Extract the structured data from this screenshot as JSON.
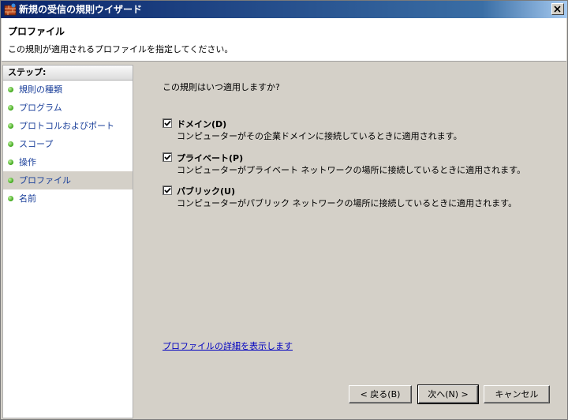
{
  "window": {
    "title": "新規の受信の規則ウイザード"
  },
  "header": {
    "title": "プロファイル",
    "subtitle": "この規則が適用されるプロファイルを指定してください。"
  },
  "steps": {
    "header": "ステップ:",
    "items": [
      {
        "label": "規則の種類",
        "active": false
      },
      {
        "label": "プログラム",
        "active": false
      },
      {
        "label": "プロトコルおよびポート",
        "active": false
      },
      {
        "label": "スコープ",
        "active": false
      },
      {
        "label": "操作",
        "active": false
      },
      {
        "label": "プロファイル",
        "active": true
      },
      {
        "label": "名前",
        "active": false
      }
    ]
  },
  "main": {
    "question": "この規則はいつ適用しますか?",
    "options": [
      {
        "label": "ドメイン(D)",
        "description": "コンピューターがその企業ドメインに接続しているときに適用されます。",
        "checked": true
      },
      {
        "label": "プライベート(P)",
        "description": "コンピューターがプライベート ネットワークの場所に接続しているときに適用されます。",
        "checked": true
      },
      {
        "label": "パブリック(U)",
        "description": "コンピューターがパブリック ネットワークの場所に接続しているときに適用されます。",
        "checked": true
      }
    ],
    "link": "プロファイルの詳細を表示します"
  },
  "buttons": {
    "back": "< 戻る(B)",
    "next": "次へ(N) >",
    "cancel": "キャンセル"
  }
}
